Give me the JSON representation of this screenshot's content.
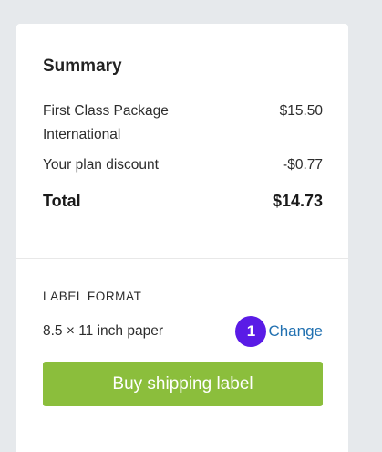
{
  "summary": {
    "title": "Summary",
    "items": [
      {
        "label": "First Class Package International",
        "amount": "$15.50"
      },
      {
        "label": "Your plan discount",
        "amount": "-$0.77"
      }
    ],
    "total": {
      "label": "Total",
      "amount": "$14.73"
    }
  },
  "label_format": {
    "heading": "LABEL FORMAT",
    "value": "8.5 × 11 inch paper",
    "step_badge": "1",
    "change_link": "Change"
  },
  "buy_button": {
    "label": "Buy shipping label",
    "color": "#8bbe3c"
  },
  "colors": {
    "accent_link": "#2271b1",
    "badge": "#5a1be6"
  }
}
